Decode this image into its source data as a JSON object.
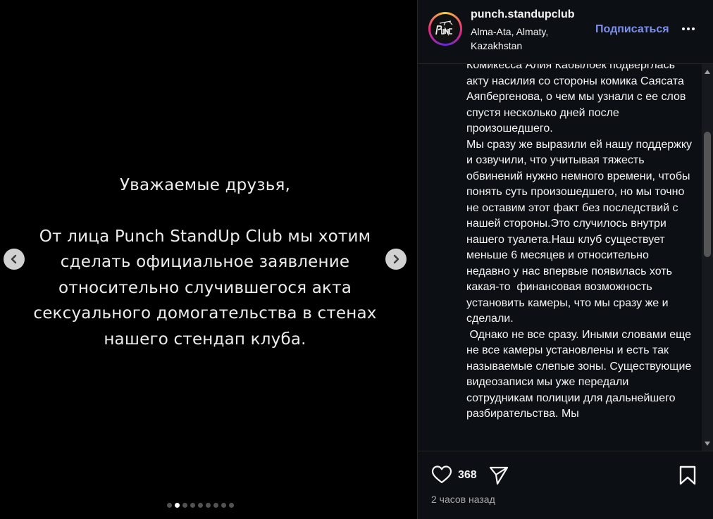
{
  "slide": {
    "greeting": "Уважаемые друзья,",
    "statement": "От лица Punch StandUp Club мы хотим сделать официальное заявление относительно случившегося акта сексуального домогательства в стенах нашего стендап клуба.",
    "dot_count": 9,
    "active_dot": 1
  },
  "post": {
    "username": "punch.standupclub",
    "location": "Alma-Ata, Almaty, Kazakhstan",
    "follow_label": "Подписаться",
    "caption": "Комикесса Алия Кабылбек подверглась акту насилия со стороны комика Саясата Аяпбергенова, о чем мы узнали с ее слов спустя несколько дней после произошедшего.\nМы сразу же выразили ей нашу поддержку и озвучили, что учитывая тяжесть обвинений нужно немного времени, чтобы понять суть произошедшего, но мы точно не оставим этот факт без последствий с нашей стороны.Это случилось внутри нашего туалета.Наш клуб существует меньше 6 месяцев и относительно недавно у нас впервые появилась хоть какая-то  финансовая возможность установить камеры, что мы сразу же и сделали.\n Однако не все сразу. Иными словами еще не все камеры установлены и есть так называемые слепые зоны. Существующие видеозаписи мы уже передали сотрудникам полиции для дальнейшего разбирательства. Мы",
    "likes": "368",
    "time": "2 часов назад"
  },
  "colors": {
    "panel_bg": "#0c1014",
    "follow": "#7d8ff0",
    "text": "#f5f5f5",
    "muted": "#a8a8a8"
  }
}
